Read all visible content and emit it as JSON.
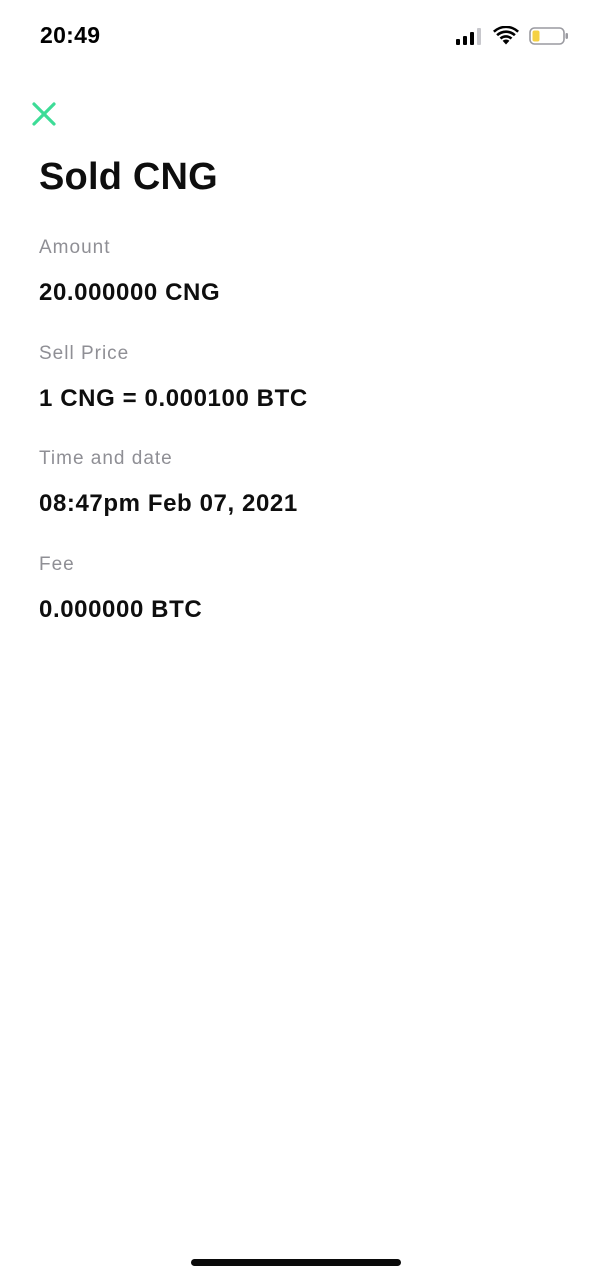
{
  "status_bar": {
    "time": "20:49",
    "icons": [
      "signal-icon",
      "wifi-icon",
      "battery-icon"
    ],
    "battery_color": "#f5d142"
  },
  "header": {
    "close_icon": "close-icon",
    "accent_color": "#3ddc97",
    "title": "Sold CNG"
  },
  "details": [
    {
      "label": "Amount",
      "value": "20.000000 CNG"
    },
    {
      "label": "Sell Price",
      "value": "1 CNG = 0.000100 BTC"
    },
    {
      "label": "Time and date",
      "value": "08:47pm Feb 07, 2021"
    },
    {
      "label": "Fee",
      "value": "0.000000 BTC"
    }
  ]
}
